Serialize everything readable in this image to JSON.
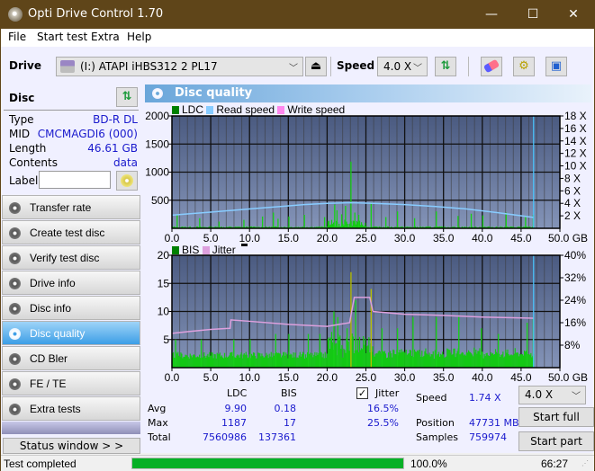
{
  "window": {
    "title": "Opti Drive Control 1.70",
    "minimize": "—",
    "maximize": "☐",
    "close": "✕"
  },
  "menu": [
    "File",
    "Start test",
    "Extra",
    "Help"
  ],
  "toolbar": {
    "drive_label": "Drive",
    "drive_value": "(I:)  ATAPI iHBS312  2 PL17",
    "speed_label": "Speed",
    "speed_value": "4.0 X",
    "icons": [
      "drive-icon",
      "eject-icon",
      "refresh-icon",
      "erase-icon",
      "settings-icon",
      "save-icon"
    ]
  },
  "disc": {
    "header": "Disc",
    "rows": [
      {
        "key": "Type",
        "value": "BD-R DL"
      },
      {
        "key": "MID",
        "value": "CMCMAGDI6 (000)"
      },
      {
        "key": "Length",
        "value": "46.61 GB"
      },
      {
        "key": "Contents",
        "value": "data"
      }
    ],
    "label_key": "Label",
    "label_value": ""
  },
  "nav": [
    {
      "label": "Transfer rate",
      "active": false
    },
    {
      "label": "Create test disc",
      "active": false
    },
    {
      "label": "Verify test disc",
      "active": false
    },
    {
      "label": "Drive info",
      "active": false
    },
    {
      "label": "Disc info",
      "active": false
    },
    {
      "label": "Disc quality",
      "active": true
    },
    {
      "label": "CD Bler",
      "active": false
    },
    {
      "label": "FE / TE",
      "active": false
    },
    {
      "label": "Extra tests",
      "active": false
    }
  ],
  "status_window_button": "Status window > >",
  "panel": {
    "title": "Disc quality"
  },
  "chart_data": [
    {
      "type": "bar",
      "title": "LDC / Read speed",
      "legend": [
        "LDC",
        "Read speed",
        "Write speed"
      ],
      "legend_colors": {
        "LDC": "#008000",
        "Read speed": "#88ccff",
        "Write speed": "#ff88ee"
      },
      "x_ticks": [
        "0.0",
        "5.0",
        "10.0",
        "15.0",
        "20.0",
        "25.0",
        "30.0",
        "35.0",
        "40.0",
        "45.0",
        "50.0 GB"
      ],
      "xlim": [
        0,
        50
      ],
      "y_left_ticks": [
        "500",
        "1000",
        "1500",
        "2000"
      ],
      "ylim_left": [
        0,
        2000
      ],
      "y_right_ticks": [
        "2 X",
        "4 X",
        "6 X",
        "8 X",
        "10 X",
        "12 X",
        "14 X",
        "16 X",
        "18 X"
      ],
      "ylim_right": [
        0,
        18
      ],
      "end_marker_gb": 46.61,
      "ldc_spikes": [
        [
          0.6,
          250
        ],
        [
          3.5,
          180
        ],
        [
          6,
          120
        ],
        [
          9.2,
          150
        ],
        [
          11.6,
          210
        ],
        [
          13,
          280
        ],
        [
          13.6,
          170
        ],
        [
          15,
          210
        ],
        [
          17,
          240
        ],
        [
          19.6,
          200
        ],
        [
          20.9,
          420
        ],
        [
          21.2,
          320
        ],
        [
          21.8,
          250
        ],
        [
          22.3,
          400
        ],
        [
          23,
          1187
        ],
        [
          23.5,
          280
        ],
        [
          24,
          240
        ],
        [
          25.6,
          460
        ],
        [
          27.5,
          200
        ],
        [
          29,
          300
        ],
        [
          31.2,
          180
        ],
        [
          34,
          300
        ],
        [
          36.8,
          220
        ],
        [
          38.5,
          260
        ],
        [
          40,
          230
        ],
        [
          43,
          280
        ],
        [
          45.5,
          200
        ],
        [
          46.5,
          240
        ]
      ],
      "read_speed": [
        [
          0,
          2.1
        ],
        [
          2,
          2.3
        ],
        [
          5,
          2.6
        ],
        [
          8,
          2.9
        ],
        [
          11,
          3.2
        ],
        [
          14,
          3.5
        ],
        [
          17,
          3.8
        ],
        [
          20,
          4.0
        ],
        [
          23,
          4.1
        ],
        [
          26,
          4.0
        ],
        [
          30,
          3.8
        ],
        [
          34,
          3.5
        ],
        [
          38,
          3.1
        ],
        [
          42,
          2.5
        ],
        [
          46.6,
          1.74
        ]
      ]
    },
    {
      "type": "bar",
      "title": "BIS / Jitter",
      "legend": [
        "BIS",
        "Jitter"
      ],
      "legend_colors": {
        "BIS": "#008000",
        "Jitter": "#dda0dd"
      },
      "x_ticks": [
        "0.0",
        "5.0",
        "10.0",
        "15.0",
        "20.0",
        "25.0",
        "30.0",
        "35.0",
        "40.0",
        "45.0",
        "50.0 GB"
      ],
      "xlim": [
        0,
        50
      ],
      "y_left_ticks": [
        "5",
        "10",
        "15",
        "20"
      ],
      "ylim_left": [
        0,
        20
      ],
      "y_right_ticks": [
        "8%",
        "16%",
        "24%",
        "32%",
        "40%"
      ],
      "ylim_right": [
        0,
        40
      ],
      "end_marker_gb": 46.61,
      "bis_spikes": [
        [
          0.4,
          5
        ],
        [
          3.7,
          5
        ],
        [
          7.9,
          5
        ],
        [
          10,
          5
        ],
        [
          13.3,
          6
        ],
        [
          15,
          6
        ],
        [
          17.5,
          6
        ],
        [
          19,
          6
        ],
        [
          20.8,
          10
        ],
        [
          21.3,
          9
        ],
        [
          22.5,
          7
        ],
        [
          23,
          17
        ],
        [
          23.6,
          12
        ],
        [
          25.6,
          14
        ],
        [
          27,
          7
        ],
        [
          29,
          7
        ],
        [
          31,
          9
        ],
        [
          34,
          9
        ],
        [
          36.9,
          9
        ],
        [
          39.8,
          7
        ],
        [
          42,
          6
        ],
        [
          45.7,
          8
        ],
        [
          46.5,
          9
        ]
      ],
      "jitter": [
        [
          0,
          12.2
        ],
        [
          2,
          12.8
        ],
        [
          5,
          13.6
        ],
        [
          7.5,
          14
        ],
        [
          7.6,
          17
        ],
        [
          10,
          16.5
        ],
        [
          15,
          15.4
        ],
        [
          20,
          14.7
        ],
        [
          22.9,
          16
        ],
        [
          23.5,
          25
        ],
        [
          25.5,
          25
        ],
        [
          25.9,
          20
        ],
        [
          30,
          19
        ],
        [
          35,
          18.6
        ],
        [
          40,
          18
        ],
        [
          46.6,
          17.6
        ]
      ]
    }
  ],
  "stats": {
    "col_ldc": "LDC",
    "col_bis": "BIS",
    "jitter_label": "Jitter",
    "jitter_checked": true,
    "rows": [
      {
        "label": "Avg",
        "ldc": "9.90",
        "bis": "0.18",
        "jitter": "16.5%"
      },
      {
        "label": "Max",
        "ldc": "1187",
        "bis": "17",
        "jitter": "25.5%"
      },
      {
        "label": "Total",
        "ldc": "7560986",
        "bis": "137361",
        "jitter": ""
      }
    ],
    "speed_label": "Speed",
    "speed_value": "1.74 X",
    "position_label": "Position",
    "position_value": "47731 MB",
    "samples_label": "Samples",
    "samples_value": "759974",
    "speed_select": "4.0 X",
    "start_full": "Start full",
    "start_part": "Start part"
  },
  "statusbar": {
    "text": "Test completed",
    "progress": 100.0,
    "progress_text": "100.0%",
    "time": "66:27"
  }
}
